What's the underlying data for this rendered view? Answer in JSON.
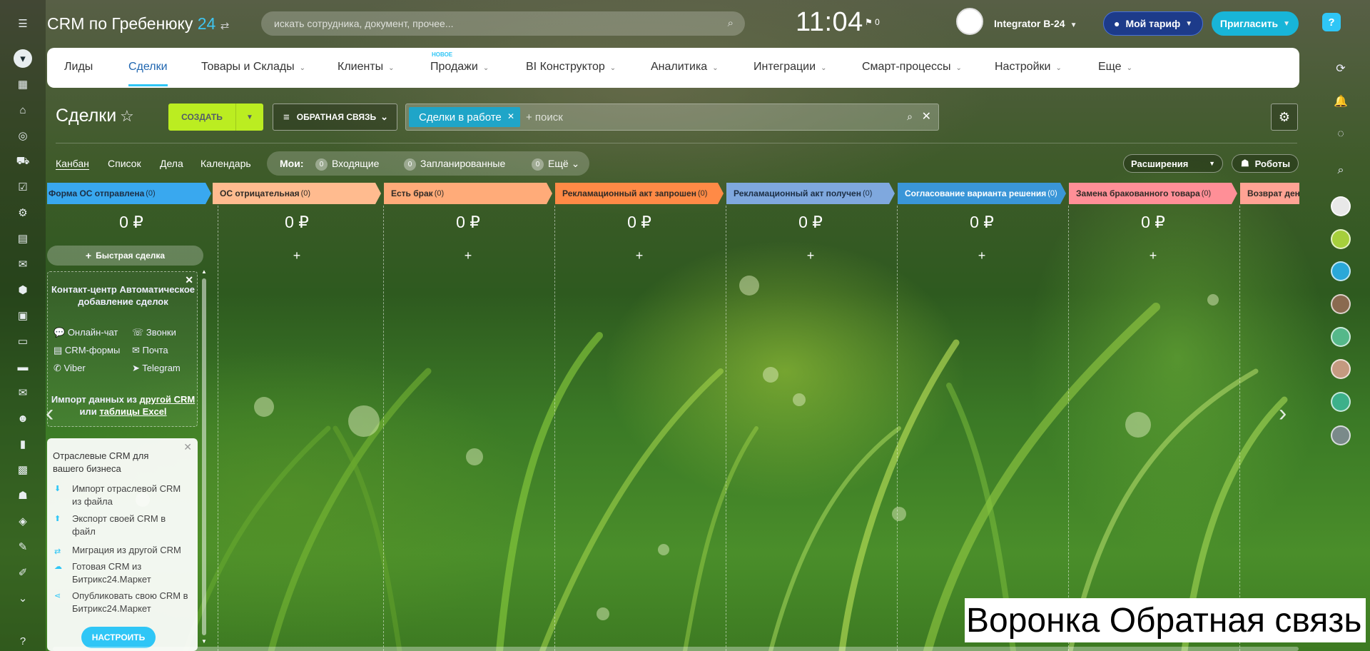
{
  "header": {
    "logo_text": "CRM по Гребенюку",
    "logo_num": "24",
    "search_placeholder": "искать сотрудника, документ, прочее...",
    "clock": "11:04",
    "flag_count": "0",
    "user_name": "Integrator B-24",
    "tariff_label": "Мой тариф",
    "invite_label": "Пригласить",
    "help_label": "?"
  },
  "nav": {
    "items": [
      {
        "label": "Лиды"
      },
      {
        "label": "Сделки"
      },
      {
        "label": "Товары и Склады"
      },
      {
        "label": "Клиенты"
      },
      {
        "label": "Продажи",
        "badge": "НОВОЕ"
      },
      {
        "label": "BI Конструктор"
      },
      {
        "label": "Аналитика"
      },
      {
        "label": "Интеграции"
      },
      {
        "label": "Смарт-процессы"
      },
      {
        "label": "Настройки"
      },
      {
        "label": "Еще"
      }
    ]
  },
  "page": {
    "title": "Сделки",
    "create_label": "СОЗДАТЬ",
    "funnel_label": "ОБРАТНАЯ СВЯЗЬ",
    "filter_tag": "Сделки в работе",
    "filter_placeholder": "+ поиск"
  },
  "views": {
    "tabs": [
      "Канбан",
      "Список",
      "Дела",
      "Календарь"
    ],
    "my_label": "Мои:",
    "counters": [
      {
        "count": "0",
        "label": "Входящие"
      },
      {
        "count": "0",
        "label": "Запланированные"
      },
      {
        "count": "0",
        "label": "Ещё"
      }
    ],
    "extensions_label": "Расширения",
    "robots_label": "Роботы"
  },
  "columns": [
    {
      "title": "Форма ОС отправлена",
      "count": "(0)",
      "sum": "0 ₽",
      "color": "#39a8ef",
      "text_color": "#1c2e44"
    },
    {
      "title": "ОС отрицательная",
      "count": "(0)",
      "sum": "0 ₽",
      "color": "#ffbb8f",
      "text_color": "#2e2a26"
    },
    {
      "title": "Есть брак",
      "count": "(0)",
      "sum": "0 ₽",
      "color": "#ffab79",
      "text_color": "#2e2a26"
    },
    {
      "title": "Рекламационный акт запрошен",
      "count": "(0)",
      "sum": "0 ₽",
      "color": "#ff8a46",
      "text_color": "#2e2a26"
    },
    {
      "title": "Рекламационный акт получен",
      "count": "(0)",
      "sum": "0 ₽",
      "color": "#7fa8de",
      "text_color": "#1c2e44"
    },
    {
      "title": "Согласование варианта решения",
      "count": "(0)",
      "sum": "0 ₽",
      "color": "#3a96d8",
      "text_color": "#ffffff"
    },
    {
      "title": "Замена бракованного товара",
      "count": "(0)",
      "sum": "0 ₽",
      "color": "#ff8f97",
      "text_color": "#2e2a26"
    },
    {
      "title": "Возврат денег",
      "count": "",
      "sum": "",
      "color": "#ffa394",
      "text_color": "#2e2a26"
    }
  ],
  "quick_deal_label": "Быстрая сделка",
  "contact_center": {
    "title": "Контакт-центр Автоматическое добавление сделок",
    "items": [
      "Онлайн-чат",
      "Звонки",
      "CRM-формы",
      "Почта",
      "Viber",
      "Telegram"
    ],
    "import_prefix": "Импорт данных из",
    "import_link1": "другой CRM",
    "import_middle": "или",
    "import_link2": "таблицы Excel"
  },
  "industry": {
    "title": "Отраслевые CRM для вашего бизнеса",
    "items": [
      "Импорт отраслевой CRM из файла",
      "Экспорт своей CRM в файл",
      "Миграция из другой CRM",
      "Готовая CRM из Битрикс24.Маркет",
      "Опубликовать свою CRM в Битрикс24.Маркет"
    ],
    "setup_label": "НАСТРОИТЬ"
  },
  "caption": "Воронка Обратная связь"
}
